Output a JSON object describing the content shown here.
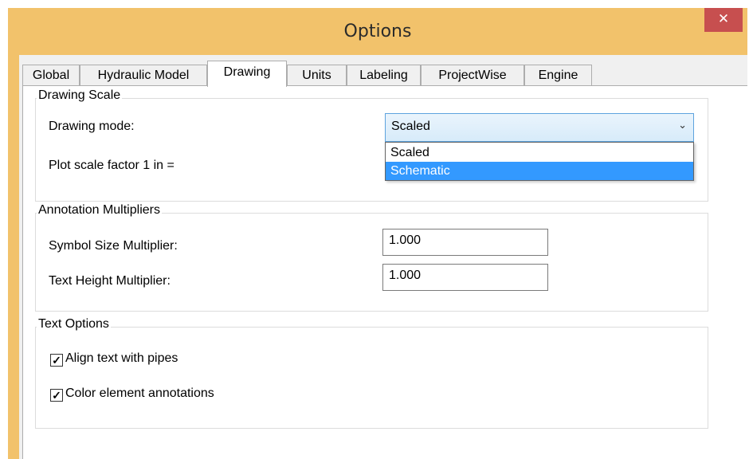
{
  "window": {
    "title": "Options",
    "close_glyph": "✕"
  },
  "tabs": [
    "Global",
    "Hydraulic Model",
    "Drawing",
    "Units",
    "Labeling",
    "ProjectWise",
    "Engine"
  ],
  "active_tab": "Drawing",
  "drawing_scale": {
    "legend": "Drawing Scale",
    "drawing_mode_label": "Drawing mode:",
    "drawing_mode_value": "Scaled",
    "drawing_mode_options": [
      "Scaled",
      "Schematic"
    ],
    "highlighted_option": "Schematic",
    "plot_scale_label": "Plot scale factor  1 in ="
  },
  "annotation": {
    "legend": "Annotation Multipliers",
    "symbol_label": "Symbol Size Multiplier:",
    "symbol_value": "1.000",
    "text_label": "Text Height Multiplier:",
    "text_value": "1.000"
  },
  "text_options": {
    "legend": "Text Options",
    "align_label": "Align text with pipes",
    "align_checked": true,
    "color_label": "Color element annotations",
    "color_checked": true,
    "check_glyph": "✓"
  },
  "colors": {
    "title_bar": "#f2c26b",
    "close_button": "#c74f4f",
    "selection": "#3399ff"
  },
  "icons": {
    "close": "close-icon",
    "dropdown": "chevron-down-icon"
  }
}
